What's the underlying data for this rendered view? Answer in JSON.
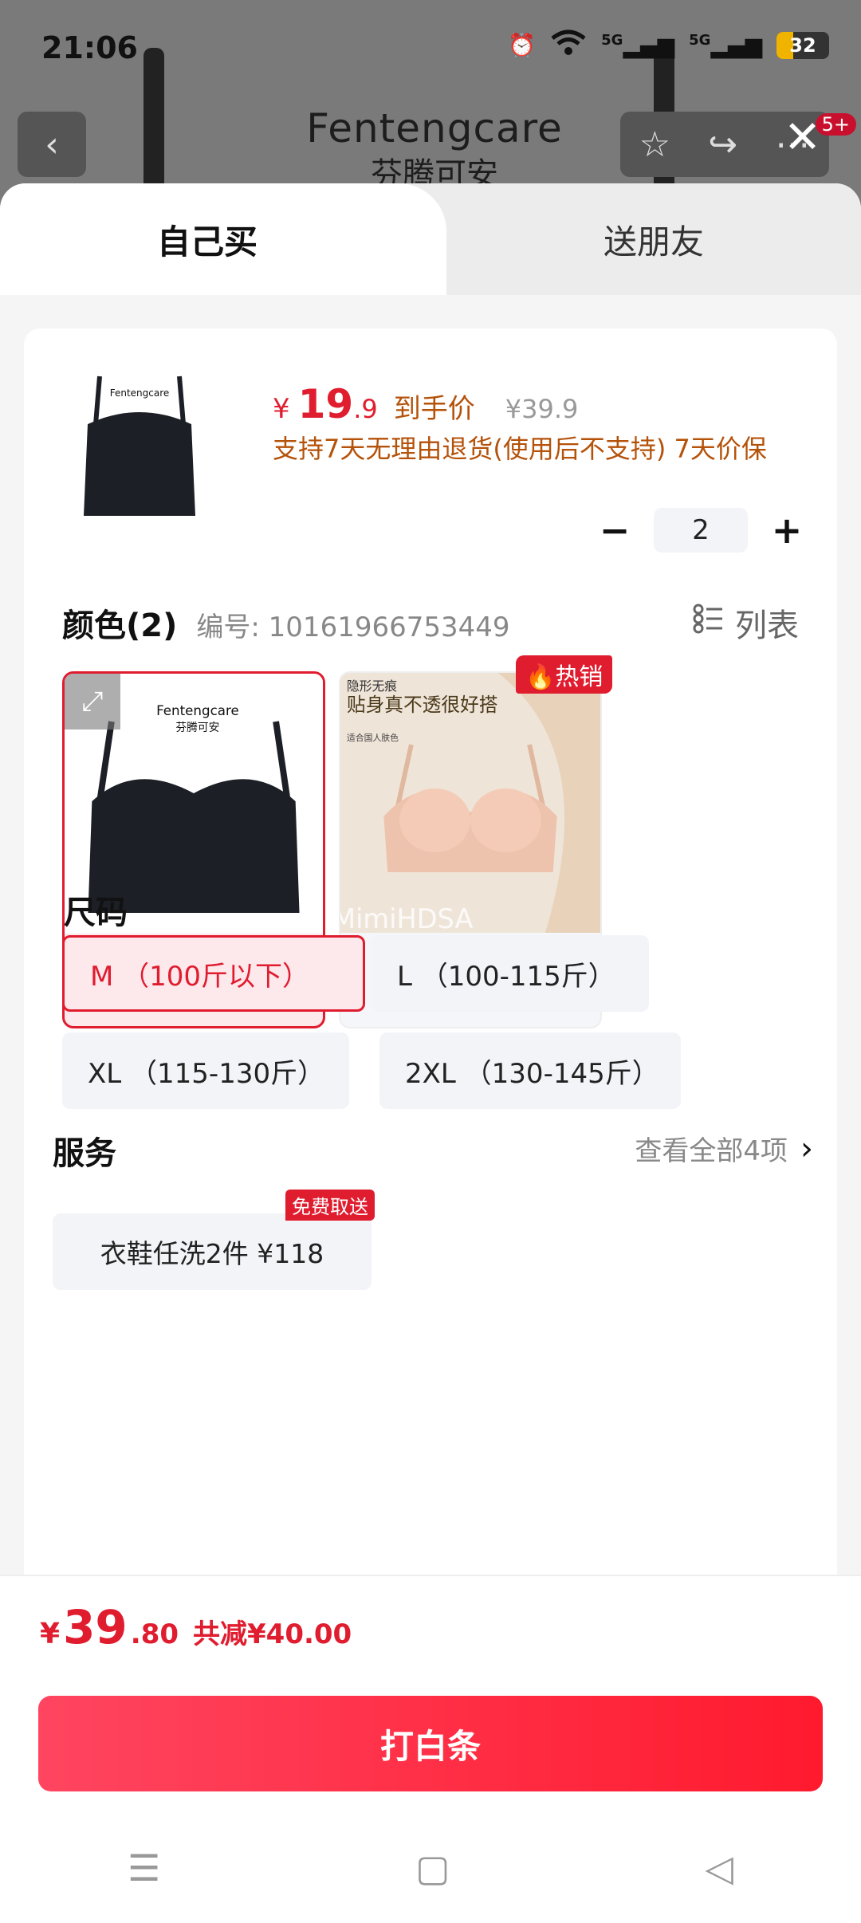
{
  "status_bar": {
    "time": "21:06",
    "network_1": "5G",
    "network_2": "5G",
    "battery": "32"
  },
  "background_page": {
    "brand_en": "Fentengcare",
    "brand_cn": "芬腾可安",
    "notification_badge": "5+"
  },
  "tabs": {
    "active": "自己买",
    "other": "送朋友"
  },
  "product": {
    "price_symbol": "¥",
    "price_int": "19",
    "price_dec": ".9",
    "price_label": "到手价",
    "original_price": "¥39.9",
    "service_note": "支持7天无理由退货(使用后不支持) 7天价保",
    "thumb_brand": "Fentengcare",
    "thumb_brand_cn": "芬腾可安"
  },
  "quantity": {
    "minus": "−",
    "value": "2",
    "plus": "+"
  },
  "color_section": {
    "title": "颜色(2)",
    "code": "编号: 10161966753449",
    "list_label": "列表",
    "options": [
      {
        "name": "黑色",
        "selected": true,
        "brand": "Fentengcare",
        "brand_cn": "芬腾可安"
      },
      {
        "name": "肤色",
        "selected": false,
        "tag": "隐形无痕",
        "caption": "贴身真不透很好搭",
        "sub": "适合国人肤色"
      }
    ],
    "hot_badge": "热销",
    "watermark": "MimiHDSA"
  },
  "size_section": {
    "title": "尺码",
    "options": [
      {
        "label": "M （100斤以下）",
        "selected": true
      },
      {
        "label": "L （100-115斤）",
        "selected": false
      },
      {
        "label": "XL （115-130斤）",
        "selected": false
      },
      {
        "label": "2XL （130-145斤）",
        "selected": false
      }
    ]
  },
  "service_section": {
    "title": "服务",
    "view_all": "查看全部4项",
    "chip_label": "衣鞋任洗2件 ¥118",
    "chip_badge": "免费取送"
  },
  "summary": {
    "yen": "¥",
    "total_int": "39",
    "total_dec": ".80",
    "saved": "共减¥40.00"
  },
  "buy_button": "打白条",
  "colors": {
    "accent": "#e01c2f",
    "price_orange": "#b5520a"
  }
}
